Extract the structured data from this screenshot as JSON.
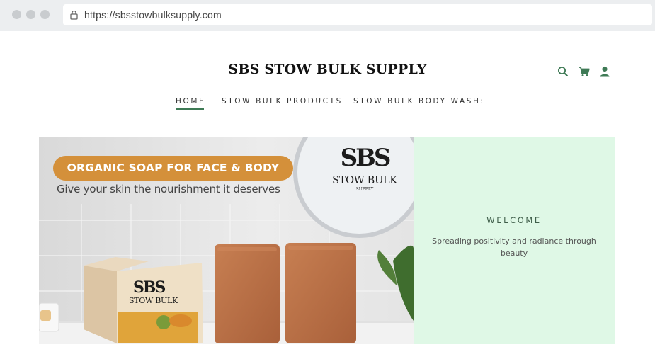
{
  "browser": {
    "url": "https://sbsstowbulksupply.com"
  },
  "header": {
    "site_title": "SBS STOW BULK SUPPLY",
    "icons": [
      "search-icon",
      "cart-icon",
      "account-icon"
    ],
    "accent_color": "#3e7a55"
  },
  "nav": {
    "items": [
      {
        "label": "HOME",
        "active": true
      },
      {
        "label": "STOW BULK PRODUCTS",
        "active": false
      },
      {
        "label": "STOW BULK BODY WASH:",
        "active": false
      }
    ]
  },
  "hero": {
    "banner_title": "ORGANIC SOAP FOR FACE & BODY",
    "banner_subtitle": "Give your skin the nourishment it deserves",
    "logo_mark": "SBS",
    "logo_name": "STOW BULK",
    "logo_supply": "SUPPLY",
    "box_logo_mark": "SBS",
    "box_logo_name": "STOW BULK",
    "pill_color": "#d4903a"
  },
  "welcome": {
    "heading": "WELCOME",
    "text": "Spreading positivity and radiance through beauty",
    "background_color": "#dff8e6"
  }
}
